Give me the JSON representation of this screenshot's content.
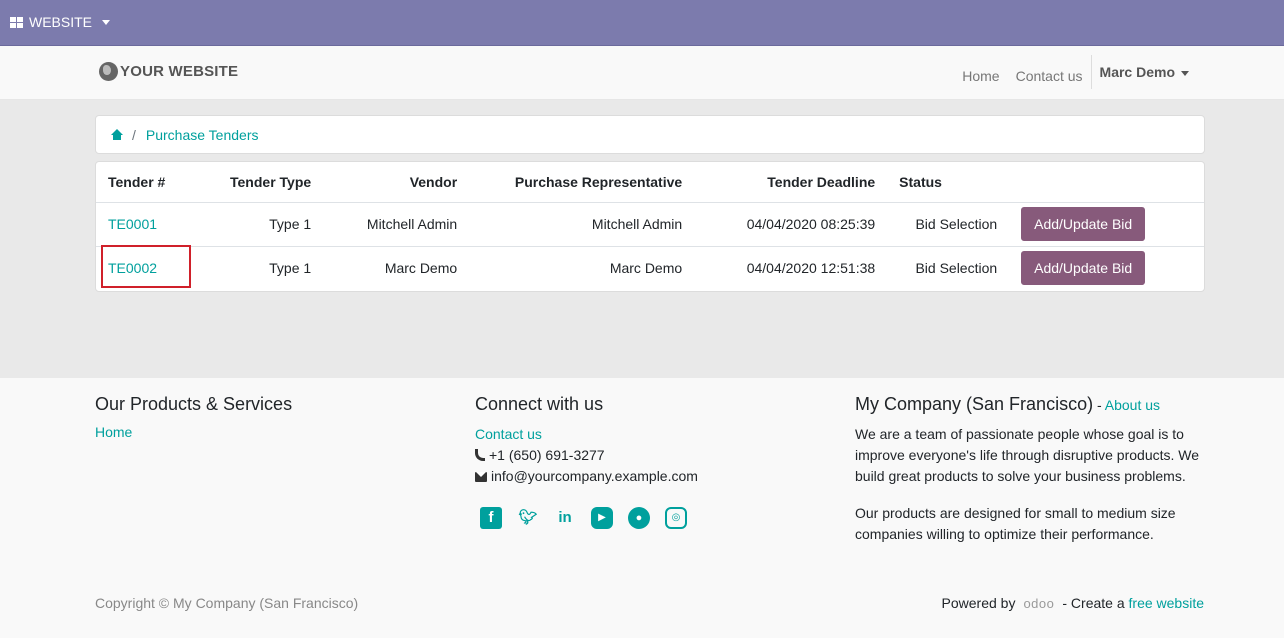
{
  "adminbar": {
    "app_label": "WEBSITE"
  },
  "header": {
    "brand": "YOUR WEBSITE",
    "nav": {
      "home": "Home",
      "contact": "Contact us",
      "user": "Marc Demo"
    }
  },
  "breadcrumb": {
    "current": "Purchase Tenders"
  },
  "table": {
    "headers": [
      "Tender #",
      "Tender Type",
      "Vendor",
      "Purchase Representative",
      "Tender Deadline",
      "Status"
    ],
    "rows": [
      {
        "tender": "TE0001",
        "type": "Type 1",
        "vendor": "Mitchell Admin",
        "rep": "Mitchell Admin",
        "deadline": "04/04/2020 08:25:39",
        "status": "Bid Selection",
        "action": "Add/Update Bid"
      },
      {
        "tender": "TE0002",
        "type": "Type 1",
        "vendor": "Marc Demo",
        "rep": "Marc Demo",
        "deadline": "04/04/2020 12:51:38",
        "status": "Bid Selection",
        "action": "Add/Update Bid"
      }
    ]
  },
  "footer": {
    "products": {
      "title": "Our Products & Services",
      "home": "Home"
    },
    "connect": {
      "title": "Connect with us",
      "contact": "Contact us",
      "phone": "+1 (650) 691-3277",
      "email": "info@yourcompany.example.com"
    },
    "company": {
      "title": "My Company (San Francisco)",
      "dash": " - ",
      "about": "About us",
      "p1": "We are a team of passionate people whose goal is to improve everyone's life through disruptive products. We build great products to solve your business problems.",
      "p2": "Our products are designed for small to medium size companies willing to optimize their performance."
    },
    "copyright": "Copyright © My Company (San Francisco)",
    "powered": {
      "prefix": "Powered by",
      "brand": "odoo",
      "middle": "- Create a",
      "link": "free website"
    }
  },
  "colors": {
    "admin_bar": "#7C7BAD",
    "link": "#00A09D",
    "button": "#875A7B",
    "highlight": "#d0202a"
  }
}
